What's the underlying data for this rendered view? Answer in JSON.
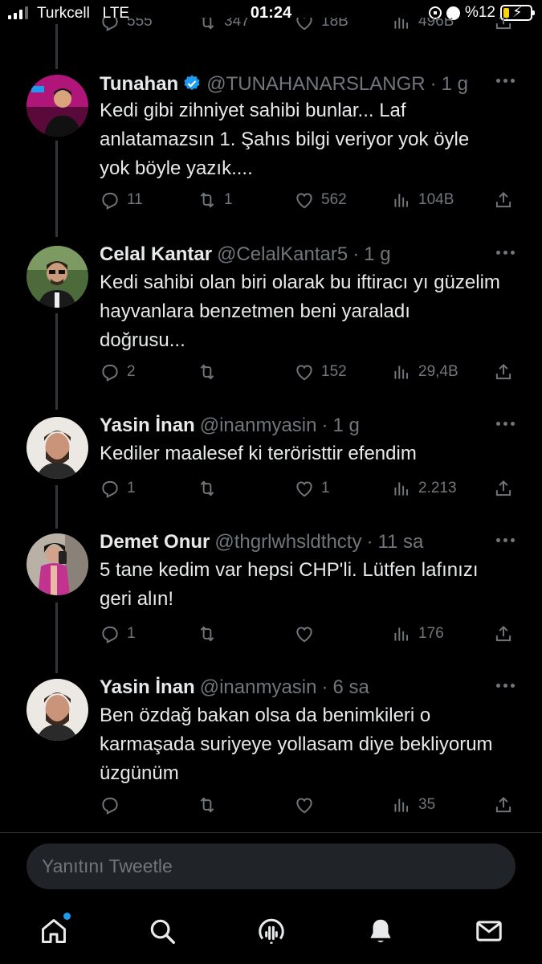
{
  "status_bar": {
    "carrier": "Turkcell",
    "network": "LTE",
    "time": "01:24",
    "battery": "%12"
  },
  "top_partial_row": {
    "replies": "555",
    "retweets": "347",
    "likes": "18B",
    "views": "496B"
  },
  "tweets": [
    {
      "name": "Tunahan",
      "verified": true,
      "handle": "@TUNAHANARSLANGR",
      "time": "1 g",
      "text": "Kedi gibi zihniyet sahibi bunlar... Laf anlatamazsın 1. Şahıs bilgi veriyor yok öyle yok böyle yazık....",
      "replies": "11",
      "retweets": "1",
      "likes": "562",
      "views": "104B"
    },
    {
      "name": "Celal Kantar",
      "verified": false,
      "handle": "@CelalKantar5",
      "time": "1 g",
      "text": "Kedi sahibi olan biri olarak bu iftiracı yı güzelim hayvanlara benzetmen beni yaraladı doğrusu...",
      "replies": "2",
      "retweets": "",
      "likes": "152",
      "views": "29,4B"
    },
    {
      "name": "Yasin İnan",
      "verified": false,
      "handle": "@inanmyasin",
      "time": "1 g",
      "text": "Kediler maalesef ki teröristtir efendim",
      "replies": "1",
      "retweets": "",
      "likes": "1",
      "views": "2.213"
    },
    {
      "name": "Demet Onur",
      "verified": false,
      "handle": "@thgrlwhsldthcty",
      "time": "11 sa",
      "text": "5 tane kedim var hepsi CHP'li. Lütfen lafınızı geri alın!",
      "replies": "1",
      "retweets": "",
      "likes": "",
      "views": "176"
    },
    {
      "name": "Yasin İnan",
      "verified": false,
      "handle": "@inanmyasin",
      "time": "6 sa",
      "text": "Ben özdağ bakan olsa da benimkileri o karmaşada suriyeye yollasam diye bekliyorum üzgünüm",
      "replies": "",
      "retweets": "",
      "likes": "",
      "views": "35"
    }
  ],
  "reply_box": {
    "placeholder": "Yanıtını Tweetle"
  },
  "nav": {
    "items": [
      "home-icon",
      "search-icon",
      "spaces-icon",
      "notifications-icon",
      "messages-icon"
    ]
  },
  "colors": {
    "background": "#000000",
    "text": "#e7e9ea",
    "muted": "#71767b",
    "accent": "#1d9bf0"
  }
}
